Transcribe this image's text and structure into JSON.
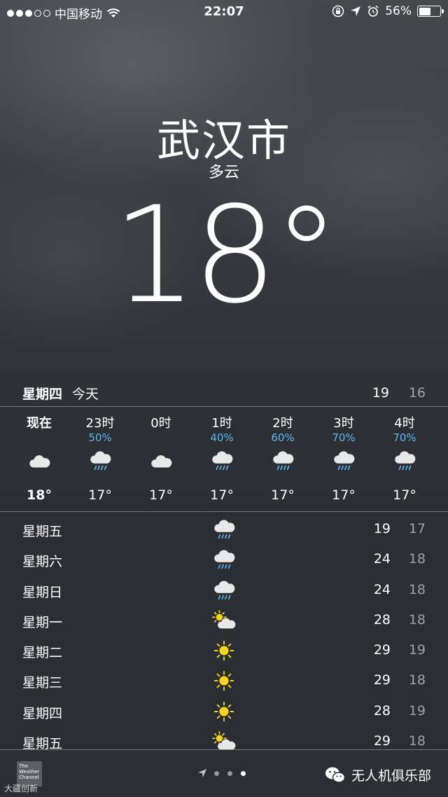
{
  "status_bar": {
    "carrier": "中国移动",
    "time": "22:07",
    "battery": "56%",
    "battery_level": 0.56
  },
  "location": {
    "city": "武汉市",
    "condition": "多云",
    "temperature": "18°"
  },
  "today": {
    "day": "星期四",
    "label": "今天",
    "high": "19",
    "low": "16"
  },
  "hourly": [
    {
      "time": "现在",
      "precip": "",
      "icon": "cloud-icon",
      "temp": "18°"
    },
    {
      "time": "23时",
      "precip": "50%",
      "icon": "rain-icon",
      "temp": "17°"
    },
    {
      "time": "0时",
      "precip": "",
      "icon": "cloud-icon",
      "temp": "17°"
    },
    {
      "time": "1时",
      "precip": "40%",
      "icon": "rain-icon",
      "temp": "17°"
    },
    {
      "time": "2时",
      "precip": "60%",
      "icon": "rain-icon",
      "temp": "17°"
    },
    {
      "time": "3时",
      "precip": "70%",
      "icon": "rain-icon",
      "temp": "17°"
    },
    {
      "time": "4时",
      "precip": "70%",
      "icon": "rain-icon",
      "temp": "17°"
    }
  ],
  "daily": [
    {
      "day": "星期五",
      "icon": "rain-icon",
      "high": "19",
      "low": "17"
    },
    {
      "day": "星期六",
      "icon": "rain-icon",
      "high": "24",
      "low": "18"
    },
    {
      "day": "星期日",
      "icon": "rain-icon",
      "high": "24",
      "low": "18"
    },
    {
      "day": "星期一",
      "icon": "partly-sunny-icon",
      "high": "28",
      "low": "18"
    },
    {
      "day": "星期二",
      "icon": "sun-icon",
      "high": "29",
      "low": "19"
    },
    {
      "day": "星期三",
      "icon": "sun-icon",
      "high": "29",
      "low": "18"
    },
    {
      "day": "星期四",
      "icon": "sun-icon",
      "high": "28",
      "low": "19"
    },
    {
      "day": "星期五",
      "icon": "partly-sunny-icon",
      "high": "29",
      "low": "18"
    }
  ],
  "footer": {
    "logo_text": "The Weather Channel",
    "watermark": "无人机俱乐部",
    "watermark2": "大疆创新",
    "page_count": 3,
    "active_page": 2
  },
  "colors": {
    "precip": "#5fb8f0",
    "sun": "#f5d327"
  }
}
